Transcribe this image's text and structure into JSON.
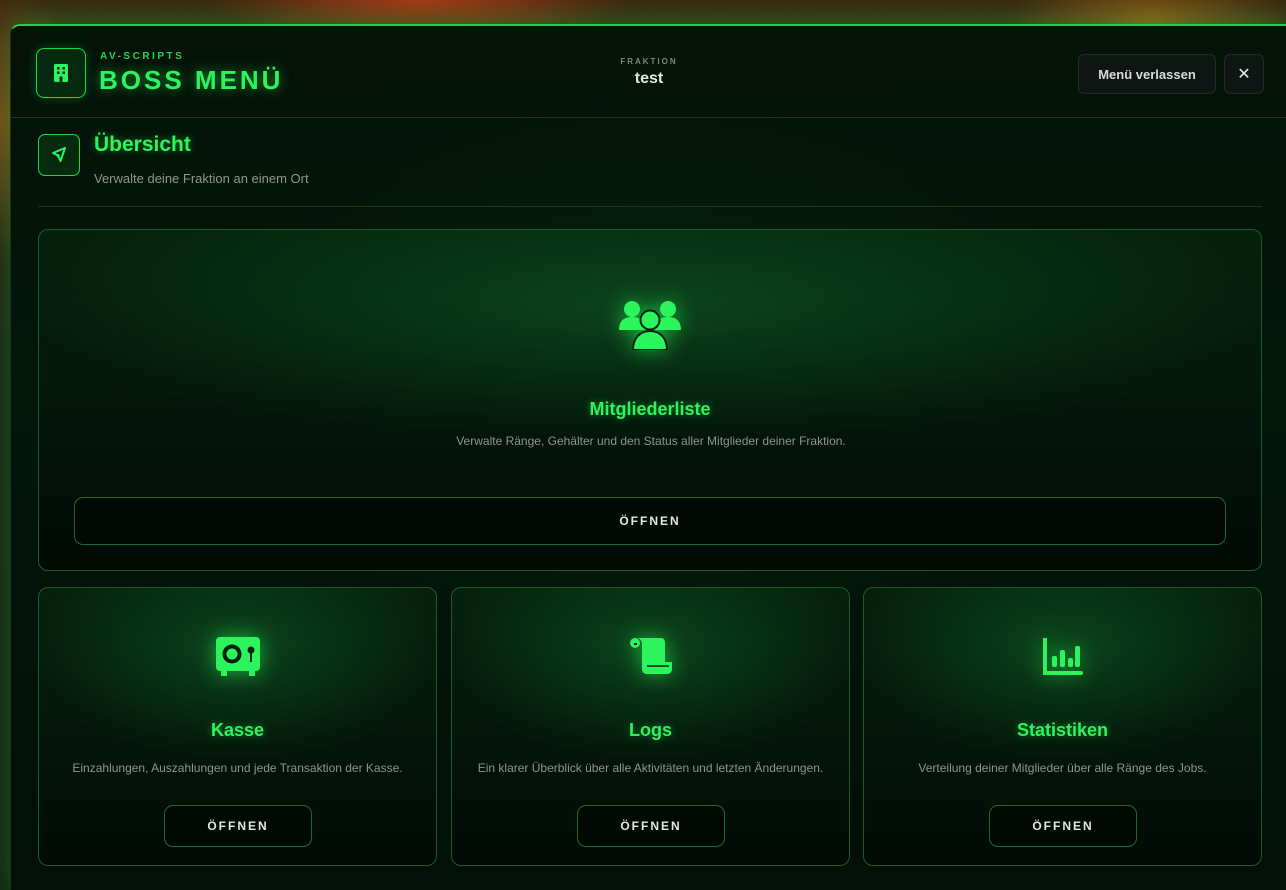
{
  "header": {
    "brand_small": "AV-SCRIPTS",
    "brand_title": "BOSS MENÜ",
    "faction_label": "FRAKTION",
    "faction_name": "test",
    "leave_label": "Menü verlassen",
    "close_label": "✕"
  },
  "section": {
    "title": "Übersicht",
    "subtitle": "Verwalte deine Fraktion an einem Ort"
  },
  "cards": [
    {
      "icon": "users-icon",
      "title": "Mitgliederliste",
      "description": "Verwalte Ränge, Gehälter und den Status aller Mitglieder deiner Fraktion.",
      "button_label": "ÖFFNEN"
    },
    {
      "icon": "vault-icon",
      "title": "Kasse",
      "description": "Einzahlungen, Auszahlungen und jede Transaktion der Kasse.",
      "button_label": "ÖFFNEN"
    },
    {
      "icon": "scroll-icon",
      "title": "Logs",
      "description": "Ein klarer Überblick über alle Aktivitäten und letzten Änderungen.",
      "button_label": "ÖFFNEN"
    },
    {
      "icon": "chart-icon",
      "title": "Statistiken",
      "description": "Verteilung deiner Mitglieder über alle Ränge des Jobs.",
      "button_label": "ÖFFNEN"
    }
  ],
  "colors": {
    "accent": "#2bf45c",
    "border": "#1d5a2c",
    "background": "#02140a"
  }
}
